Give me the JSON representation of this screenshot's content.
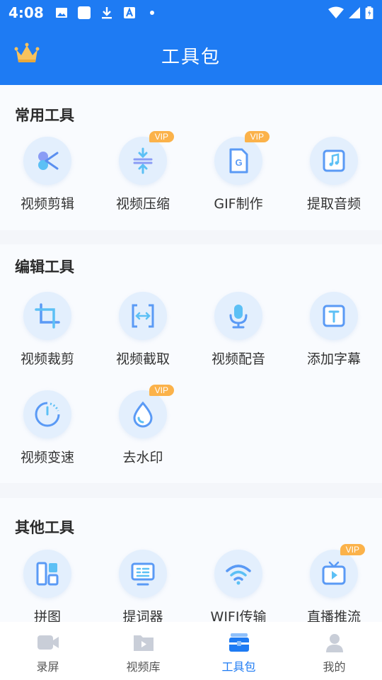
{
  "status_bar": {
    "time": "4:08"
  },
  "header": {
    "title": "工具包"
  },
  "sections": [
    {
      "title": "常用工具",
      "tools": [
        {
          "label": "视频剪辑",
          "icon": "scissors-icon",
          "vip": ""
        },
        {
          "label": "视频压缩",
          "icon": "compress-icon",
          "vip": "VIP"
        },
        {
          "label": "GIF制作",
          "icon": "gif-icon",
          "vip": "VIP"
        },
        {
          "label": "提取音频",
          "icon": "music-note-icon",
          "vip": ""
        }
      ]
    },
    {
      "title": "编辑工具",
      "tools": [
        {
          "label": "视频裁剪",
          "icon": "crop-icon",
          "vip": ""
        },
        {
          "label": "视频截取",
          "icon": "trim-icon",
          "vip": ""
        },
        {
          "label": "视频配音",
          "icon": "microphone-icon",
          "vip": ""
        },
        {
          "label": "添加字幕",
          "icon": "subtitle-icon",
          "vip": ""
        },
        {
          "label": "视频变速",
          "icon": "speedometer-icon",
          "vip": ""
        },
        {
          "label": "去水印",
          "icon": "water-drop-icon",
          "vip": "VIP"
        }
      ]
    },
    {
      "title": "其他工具",
      "tools": [
        {
          "label": "拼图",
          "icon": "collage-icon",
          "vip": ""
        },
        {
          "label": "提词器",
          "icon": "teleprompter-icon",
          "vip": ""
        },
        {
          "label": "WIFI传输",
          "icon": "wifi-icon",
          "vip": ""
        },
        {
          "label": "直播推流",
          "icon": "live-tv-icon",
          "vip": "VIP"
        }
      ]
    }
  ],
  "tabbar": {
    "items": [
      {
        "label": "录屏"
      },
      {
        "label": "视频库"
      },
      {
        "label": "工具包"
      },
      {
        "label": "我的"
      }
    ]
  },
  "colors": {
    "primary": "#1e7bf3",
    "vip": "#fbb24a",
    "icon_circle": "#e3effd"
  }
}
